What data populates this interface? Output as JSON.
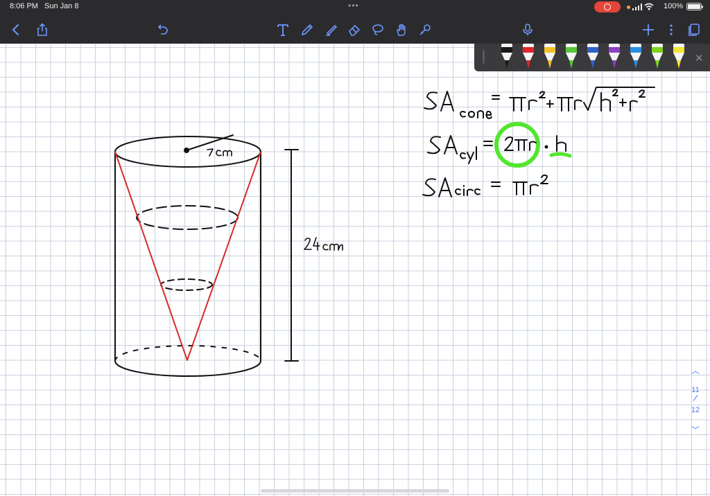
{
  "status_bar": {
    "time": "8:06 PM",
    "date": "Sun Jan 8",
    "dots": "•••",
    "battery": "100%"
  },
  "toolbar": {
    "accent_color": "#6f97ff",
    "icons": [
      "back-icon",
      "share-icon",
      "undo-icon",
      "text-tool-icon",
      "pen-tool-icon",
      "highlighter-icon",
      "eraser-icon",
      "lasso-icon",
      "hand-icon",
      "laser-pointer-icon",
      "microphone-icon",
      "add-page-icon",
      "more-icon",
      "pages-icon"
    ]
  },
  "pen_colors": [
    "#1a1a1a",
    "#e0262b",
    "#f2c12a",
    "#58c63a",
    "#2e62c9",
    "#8d3fc6",
    "#2a8fe0",
    "#7ed321",
    "#f4e532"
  ],
  "page": {
    "current": "11",
    "total": "12"
  },
  "annotations": {
    "radius_label": "7cm",
    "height_label": "24cm",
    "formula_cone": "SA cone = πr² + πr√(h²+r²)",
    "formula_cyl": "SA cyl = 2πr · h",
    "formula_circ": "SA circ = πr²"
  }
}
